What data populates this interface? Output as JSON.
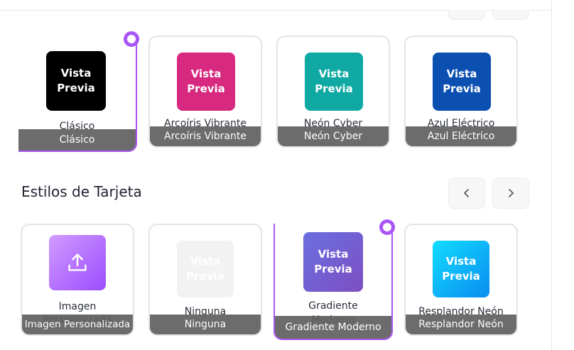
{
  "colors": {
    "accent": "#a855f7",
    "bar": "#5f5f5f"
  },
  "section_top": {
    "cards": [
      {
        "name": "Clásico",
        "bar": "Clásico",
        "preview_line1": "Vista",
        "preview_line2": "Previa",
        "preview_bg": "#000000",
        "selected": true
      },
      {
        "name": "Arcoíris Vibrante",
        "bar": "Arcoíris Vibrante",
        "preview_line1": "Vista",
        "preview_line2": "Previa",
        "preview_bg": "#d6297f",
        "selected": false
      },
      {
        "name": "Neón Cyber",
        "bar": "Neón Cyber",
        "preview_line1": "Vista",
        "preview_line2": "Previa",
        "preview_bg": "#0fa8a2",
        "selected": false
      },
      {
        "name": "Azul Eléctrico",
        "bar": "Azul Eléctrico",
        "preview_line1": "Vista",
        "preview_line2": "Previa",
        "preview_bg": "#0b4fb0",
        "selected": false
      }
    ]
  },
  "section_bottom": {
    "title": "Estilos de Tarjeta",
    "prev_icon": "chevron-left-icon",
    "next_icon": "chevron-right-icon",
    "cards": [
      {
        "name": "Imagen Personalizada",
        "bar": "Imagen Personalizada",
        "icon": "upload-icon",
        "selected": false
      },
      {
        "name": "Ninguna",
        "bar": "Ninguna",
        "preview_line1": "Vista",
        "preview_line2": "Previa",
        "selected": false
      },
      {
        "name": "Gradiente Moderno",
        "bar": "Gradiente Moderno",
        "preview_line1": "Vista",
        "preview_line2": "Previa",
        "selected": true
      },
      {
        "name": "Resplandor Neón",
        "bar": "Resplandor Neón",
        "preview_line1": "Vista",
        "preview_line2": "Previa",
        "selected": false
      }
    ]
  }
}
